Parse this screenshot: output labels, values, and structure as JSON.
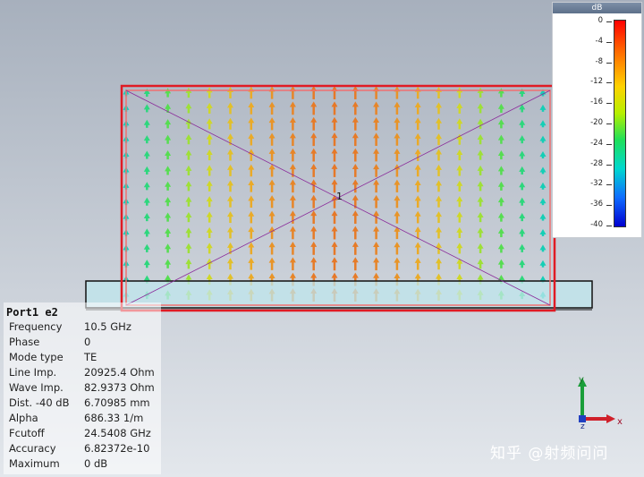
{
  "info": {
    "title": "Port1 e2",
    "rows": [
      {
        "label": "Frequency",
        "value": "10.5 GHz"
      },
      {
        "label": "Phase",
        "value": "0"
      },
      {
        "label": "Mode type",
        "value": "TE"
      },
      {
        "label": "Line Imp.",
        "value": "20925.4 Ohm"
      },
      {
        "label": "Wave Imp.",
        "value": "82.9373 Ohm"
      },
      {
        "label": "Dist. -40 dB",
        "value": "6.70985 mm"
      },
      {
        "label": "Alpha",
        "value": "686.33 1/m"
      },
      {
        "label": "Fcutoff",
        "value": "24.5408 GHz"
      },
      {
        "label": "Accuracy",
        "value": "6.82372e-10"
      },
      {
        "label": "Maximum",
        "value": "0 dB"
      }
    ]
  },
  "legend": {
    "unit": "dB",
    "ticks": [
      "0",
      "-4",
      "-8",
      "-12",
      "-16",
      "-20",
      "-24",
      "-28",
      "-32",
      "-36",
      "-40"
    ],
    "colors": [
      "#ff0000",
      "#ff6a00",
      "#ffd200",
      "#b6f000",
      "#1fe05a",
      "#00d7cf",
      "#0f6cff",
      "#0000d0"
    ]
  },
  "scene": {
    "port_label": "1",
    "port_frame_color": "#e01b24",
    "substrate_color": "#bfe6ec",
    "diagonal_color": "#8a2a9a"
  },
  "axes": {
    "x": "x",
    "y": "y",
    "z": "z"
  },
  "watermark": "知乎 @射频问问"
}
